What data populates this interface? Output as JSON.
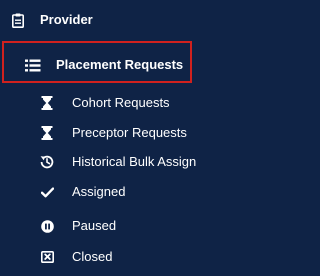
{
  "section": {
    "title": "Provider",
    "icon": "clipboard-icon"
  },
  "active_item": {
    "label": "Placement Requests",
    "icon": "list-icon"
  },
  "items": [
    {
      "label": "Cohort Requests",
      "icon": "hourglass-icon"
    },
    {
      "label": "Preceptor Requests",
      "icon": "hourglass-icon"
    },
    {
      "label": "Historical Bulk Assign",
      "icon": "history-icon"
    },
    {
      "label": "Assigned",
      "icon": "check-icon"
    },
    {
      "label": "Paused",
      "icon": "pause-circle-icon"
    },
    {
      "label": "Closed",
      "icon": "close-box-icon"
    }
  ],
  "colors": {
    "background": "#0f2346",
    "text": "#ffffff",
    "highlight_border": "#d0211e"
  }
}
